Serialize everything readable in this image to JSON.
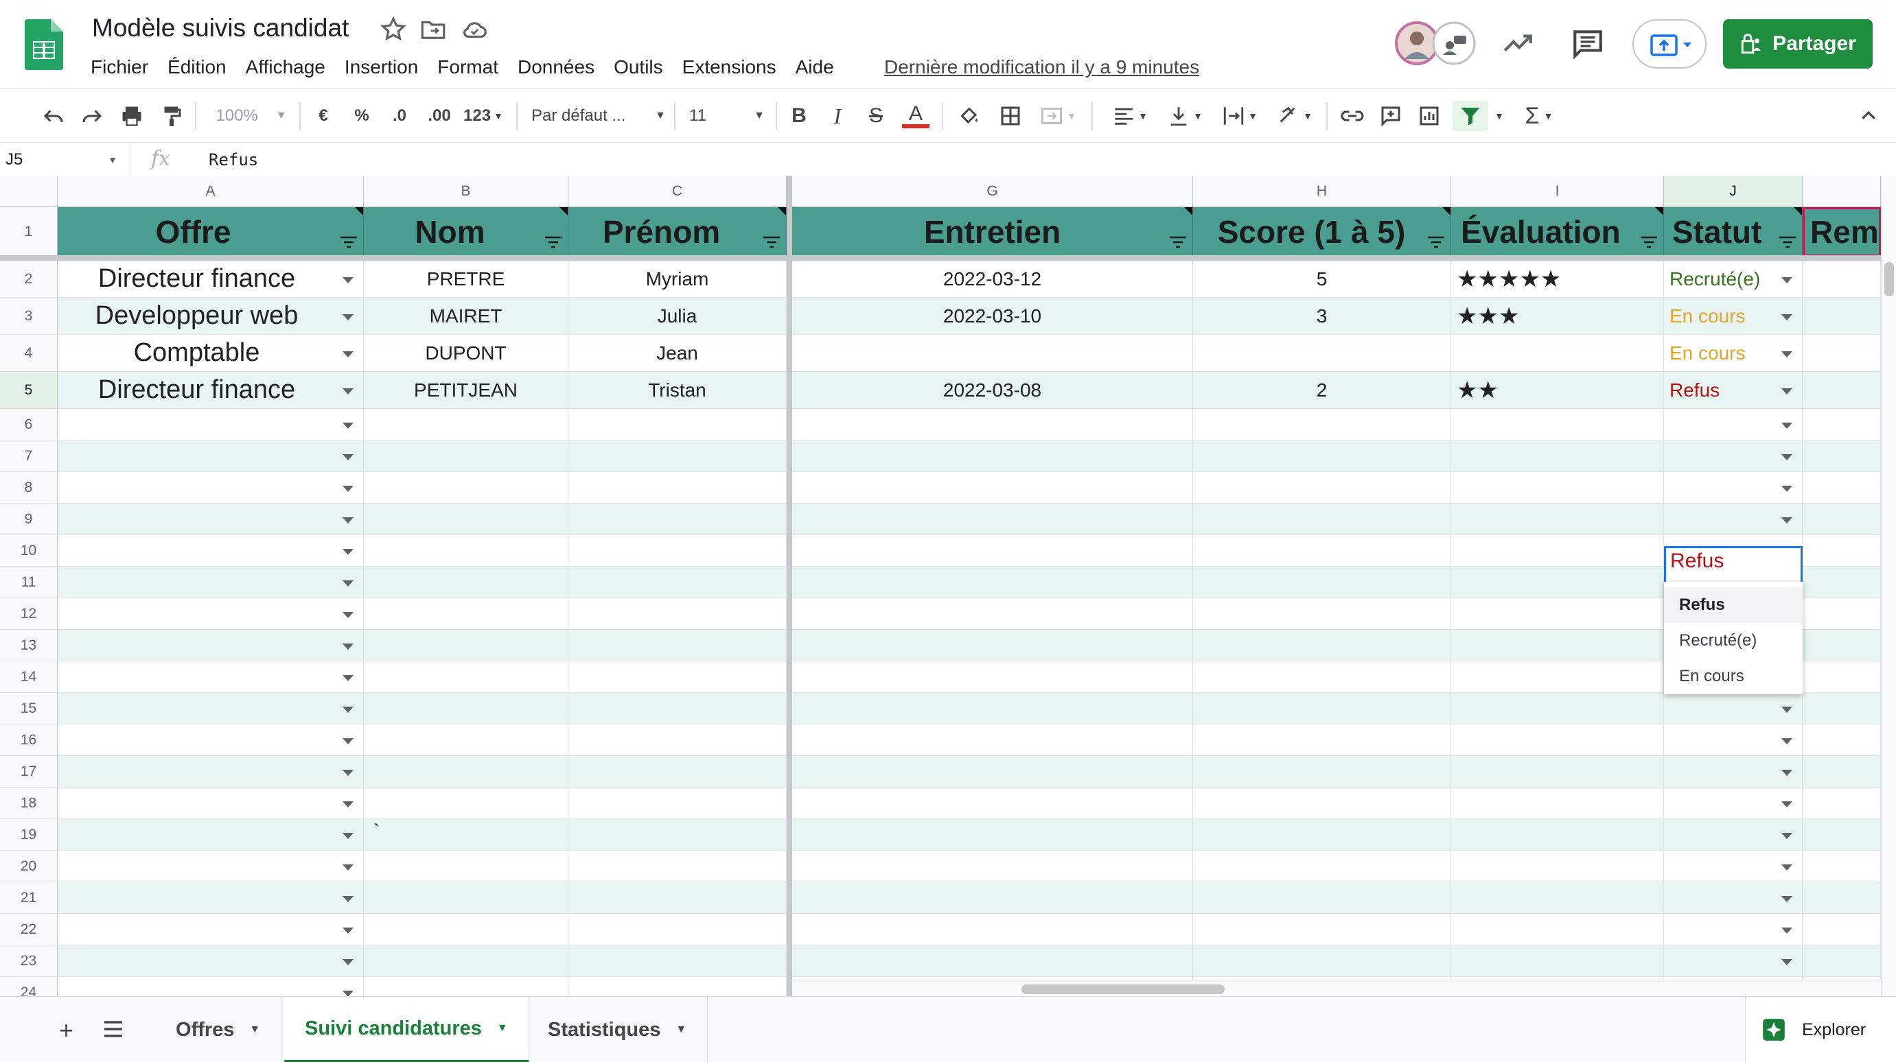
{
  "doc": {
    "title": "Modèle suivis candidat",
    "last_edit": "Dernière modification il y a 9 minutes"
  },
  "menu": [
    "Fichier",
    "Édition",
    "Affichage",
    "Insertion",
    "Format",
    "Données",
    "Outils",
    "Extensions",
    "Aide"
  ],
  "share_label": "Partager",
  "toolbar": {
    "zoom": "100%",
    "currency": "€",
    "percent": "%",
    "dec_less": ".0",
    "dec_more": ".00",
    "more_formats": "123",
    "font": "Par défaut ...",
    "font_size": "11",
    "bold": "B",
    "italic": "I",
    "strike": "S",
    "text_color": "A",
    "functions": "Σ"
  },
  "formula_bar": {
    "cell_ref": "J5",
    "fx": "fx",
    "content": "Refus"
  },
  "columns": [
    "A",
    "B",
    "C",
    "G",
    "H",
    "I",
    "J"
  ],
  "headers": {
    "offre": "Offre",
    "nom": "Nom",
    "prenom": "Prénom",
    "entretien": "Entretien",
    "score": "Score (1 à 5)",
    "evaluation": "Évaluation",
    "statut": "Statut",
    "rem": "Rem"
  },
  "rows": [
    {
      "n": "1"
    },
    {
      "n": "2",
      "offre": "Directeur finance",
      "nom": "PRETRE",
      "prenom": "Myriam",
      "entretien": "2022-03-12",
      "score": "5",
      "evaluation": "★★★★★",
      "statut": "Recruté(e)"
    },
    {
      "n": "3",
      "offre": "Developpeur web",
      "nom": "MAIRET",
      "prenom": "Julia",
      "entretien": "2022-03-10",
      "score": "3",
      "evaluation": "★★★",
      "statut": "En cours"
    },
    {
      "n": "4",
      "offre": "Comptable",
      "nom": "DUPONT",
      "prenom": "Jean",
      "entretien": "",
      "score": "",
      "evaluation": "",
      "statut": "En cours"
    },
    {
      "n": "5",
      "offre": "Directeur finance",
      "nom": "PETITJEAN",
      "prenom": "Tristan",
      "entretien": "2022-03-08",
      "score": "2",
      "evaluation": "★★",
      "statut": "Refus"
    }
  ],
  "empty_rows": [
    "6",
    "7",
    "8",
    "9",
    "10",
    "11",
    "12",
    "13",
    "14",
    "15",
    "16",
    "17",
    "18",
    "19",
    "20",
    "21",
    "22",
    "23",
    "24"
  ],
  "row19_note": "`",
  "colors": {
    "header_bg": "#4a9e90",
    "band": "#e8f4f1",
    "recrute": "#38761d",
    "en_cours": "#e8a427",
    "refus": "#b31412",
    "share": "#1e8e3e"
  },
  "dropdown": {
    "current": "Refus",
    "options": [
      "Refus",
      "Recruté(e)",
      "En cours"
    ]
  },
  "sheet_tabs": [
    "Offres",
    "Suivi candidatures",
    "Statistiques"
  ],
  "active_tab": "Suivi candidatures",
  "explore_label": "Explorer"
}
